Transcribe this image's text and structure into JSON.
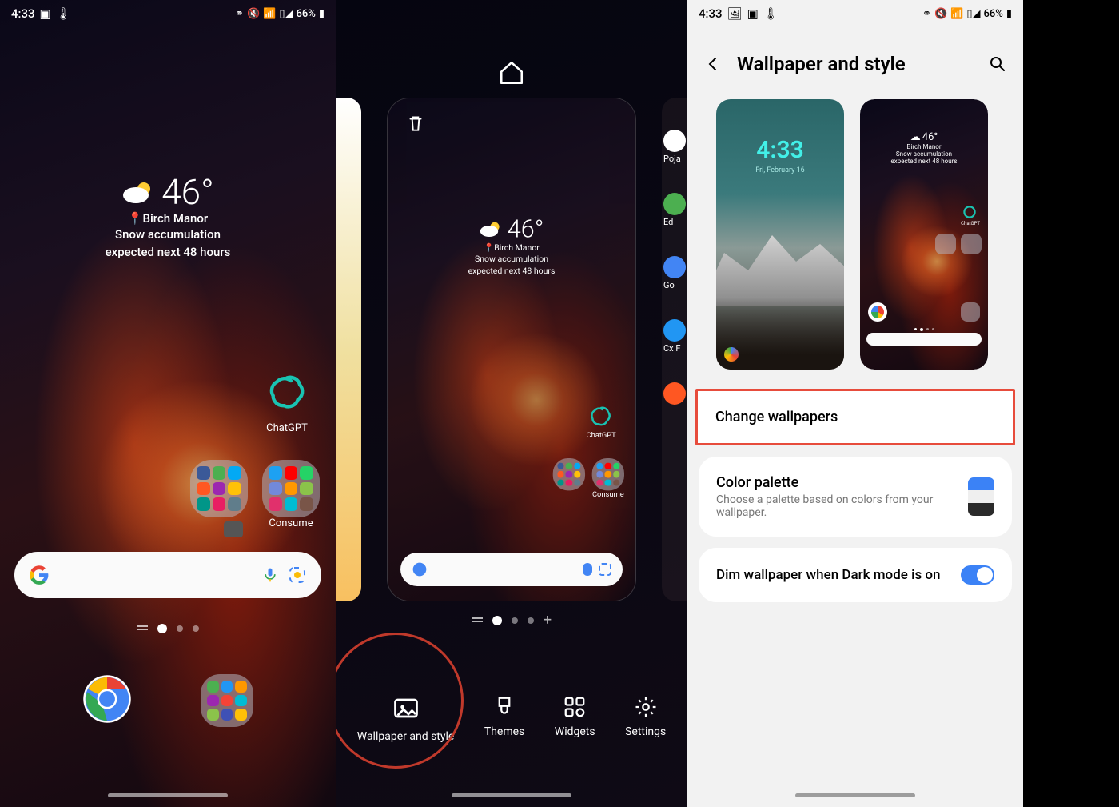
{
  "status": {
    "time": "4:33",
    "battery": "66%",
    "icons_left": [
      "picture-icon",
      "battery-saver-icon",
      "thermo-icon"
    ],
    "icons_right": [
      "bluetooth-icon",
      "mute-icon",
      "wifi-icon",
      "signal-icon"
    ]
  },
  "weather": {
    "temp": "46°",
    "location": "Birch Manor",
    "line1": "Snow accumulation",
    "line2": "expected next 48 hours"
  },
  "home": {
    "chatgpt_label": "ChatGPT",
    "folder2_label": "Consume"
  },
  "editor": {
    "actions": {
      "wallpaper": "Wallpaper and style",
      "themes": "Themes",
      "widgets": "Widgets",
      "settings": "Settings"
    },
    "side_labels": [
      "Poja",
      "Ed",
      "Go",
      "Cx F"
    ]
  },
  "settings": {
    "title": "Wallpaper and style",
    "lock_time": "4:33",
    "lock_date": "Fri, February 16",
    "change": "Change wallpapers",
    "palette_title": "Color palette",
    "palette_sub": "Choose a palette based on colors from your wallpaper.",
    "palette_colors": [
      "#3b82f6",
      "#efefef",
      "#2a2a2a"
    ],
    "dim_label": "Dim wallpaper when Dark mode is on"
  }
}
